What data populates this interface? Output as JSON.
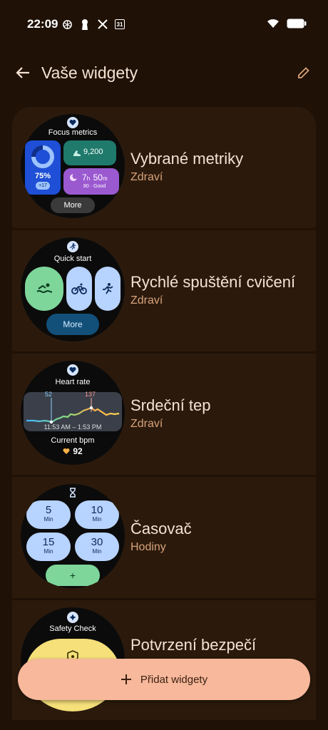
{
  "status": {
    "time": "22:09",
    "icons_left": [
      "openai-icon",
      "keyhole-icon",
      "x-icon",
      "calendar-icon"
    ],
    "calendar_day": "31",
    "icons_right": [
      "wifi-icon",
      "battery-icon"
    ]
  },
  "header": {
    "title": "Vaše widgety",
    "back_icon": "back-arrow-icon",
    "edit_icon": "edit-pencil-icon"
  },
  "widgets": [
    {
      "title": "Vybrané metriky",
      "category": "Zdraví",
      "preview": {
        "label": "Focus metrics",
        "ring_value": "75%",
        "ring_badge": "+17",
        "steps": "9,200",
        "sleep_h": "7",
        "sleep_h_unit": "h",
        "sleep_m": "50",
        "sleep_m_unit": "m",
        "sleep_note": "80 · Good",
        "button": "More"
      }
    },
    {
      "title": "Rychlé spuštění cvičení",
      "category": "Zdraví",
      "preview": {
        "label": "Quick start",
        "button": "More",
        "activities": [
          "swim-icon",
          "bike-icon",
          "run-icon"
        ]
      }
    },
    {
      "title": "Srdeční tep",
      "category": "Zdraví",
      "preview": {
        "label": "Heart rate",
        "min_value": "52",
        "max_value": "137",
        "range": "11:53 AM – 1:53 PM",
        "current_label": "Current bpm",
        "current_value": "92"
      }
    },
    {
      "title": "Časovač",
      "category": "Hodiny",
      "preview": {
        "timers": [
          {
            "value": "5",
            "unit": "Min"
          },
          {
            "value": "10",
            "unit": "Min"
          },
          {
            "value": "15",
            "unit": "Min"
          },
          {
            "value": "30",
            "unit": "Min"
          }
        ],
        "add": "+"
      }
    },
    {
      "title": "Potvrzení bezpečí",
      "category": "",
      "preview": {
        "label": "Safety Check"
      }
    }
  ],
  "fab": {
    "label": "Přidat widgety",
    "icon": "plus-icon"
  },
  "colors": {
    "background": "#1f1106",
    "card": "#2b1a0c",
    "accent_text": "#d7a27a",
    "fab": "#f7b89b"
  }
}
